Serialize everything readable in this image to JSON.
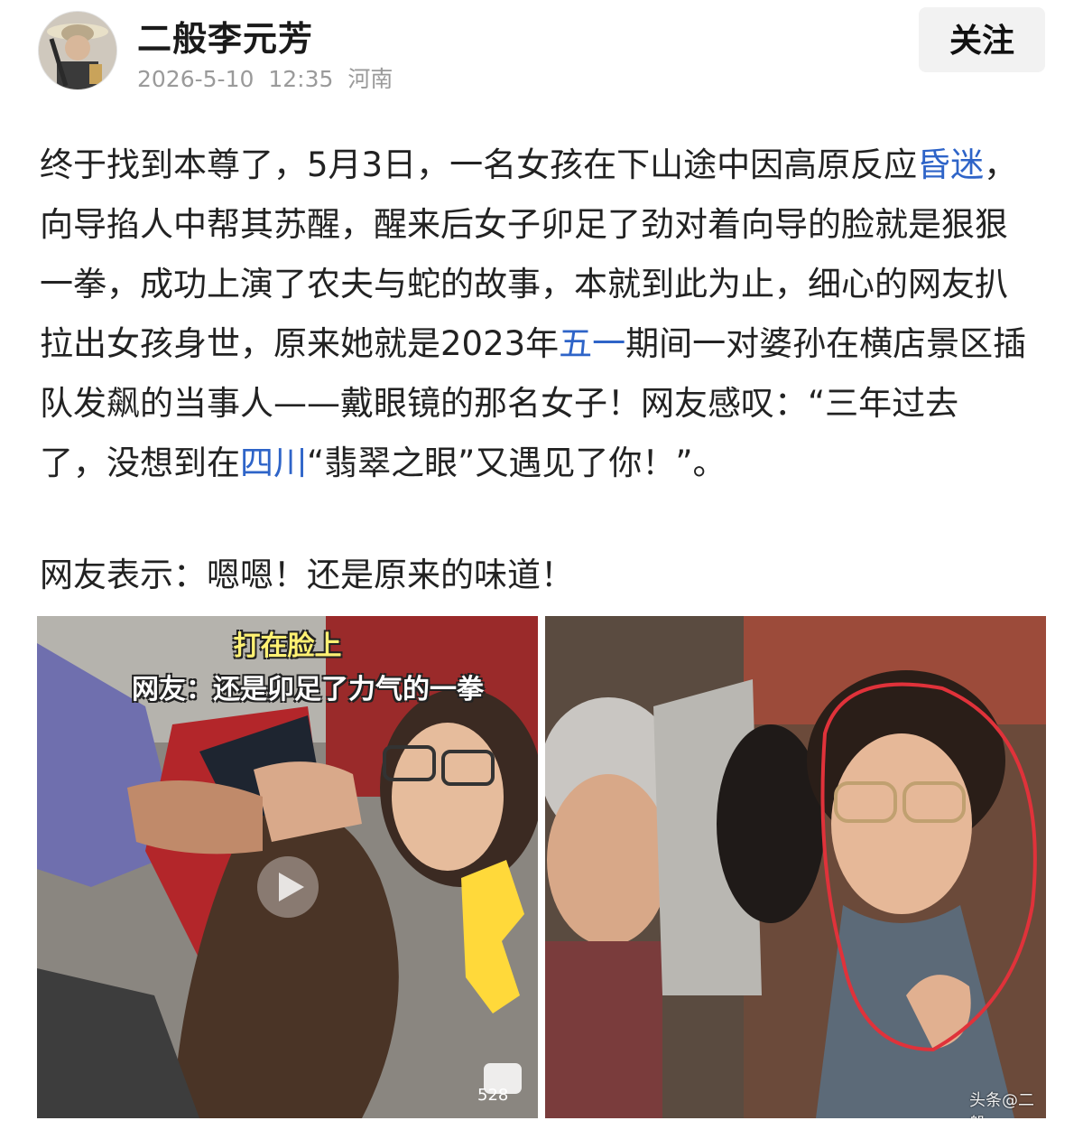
{
  "author": {
    "name": "二般李元芳",
    "date": "2026-5-10",
    "time": "12:35",
    "location": "河南",
    "follow_label": "关注"
  },
  "post": {
    "lines": [
      [
        {
          "t": "终于找到本尊了，5月3日，一名女孩在下山途中因高原反应"
        },
        {
          "t": "昏迷",
          "link": true
        },
        {
          "t": "，"
        }
      ],
      [
        {
          "t": "向导掐人中帮其苏醒，醒来后女子卯足了劲对着向导的脸就是狠狠"
        }
      ],
      [
        {
          "t": "一拳，成功上演了农夫与蛇的故事，本就到此为止，细心的网友扒"
        }
      ],
      [
        {
          "t": "拉出女孩身世，原来她就是2023年"
        },
        {
          "t": "五一",
          "link": true
        },
        {
          "t": "期间一对婆孙在横店景区插"
        }
      ],
      [
        {
          "t": "队发飙的当事人——戴眼镜的那名女子！网友感叹：“三年过去"
        }
      ],
      [
        {
          "t": "了，没想到在"
        },
        {
          "t": "四川",
          "link": true
        },
        {
          "t": "“翡翠之眼”又遇见了你！”。"
        }
      ]
    ],
    "comment": "网友表示：嗯嗯！还是原来的味道！"
  },
  "images": {
    "left": {
      "caption_top": "打在脸上",
      "caption_sub": "网友：还是卯足了力气的一拳",
      "comment_count": "528"
    },
    "right": {
      "watermark": "头条@二般"
    }
  },
  "colors": {
    "link": "#2e64c8",
    "text": "#222222",
    "meta": "#9a9a9a",
    "follow_bg": "#f2f2f2"
  }
}
